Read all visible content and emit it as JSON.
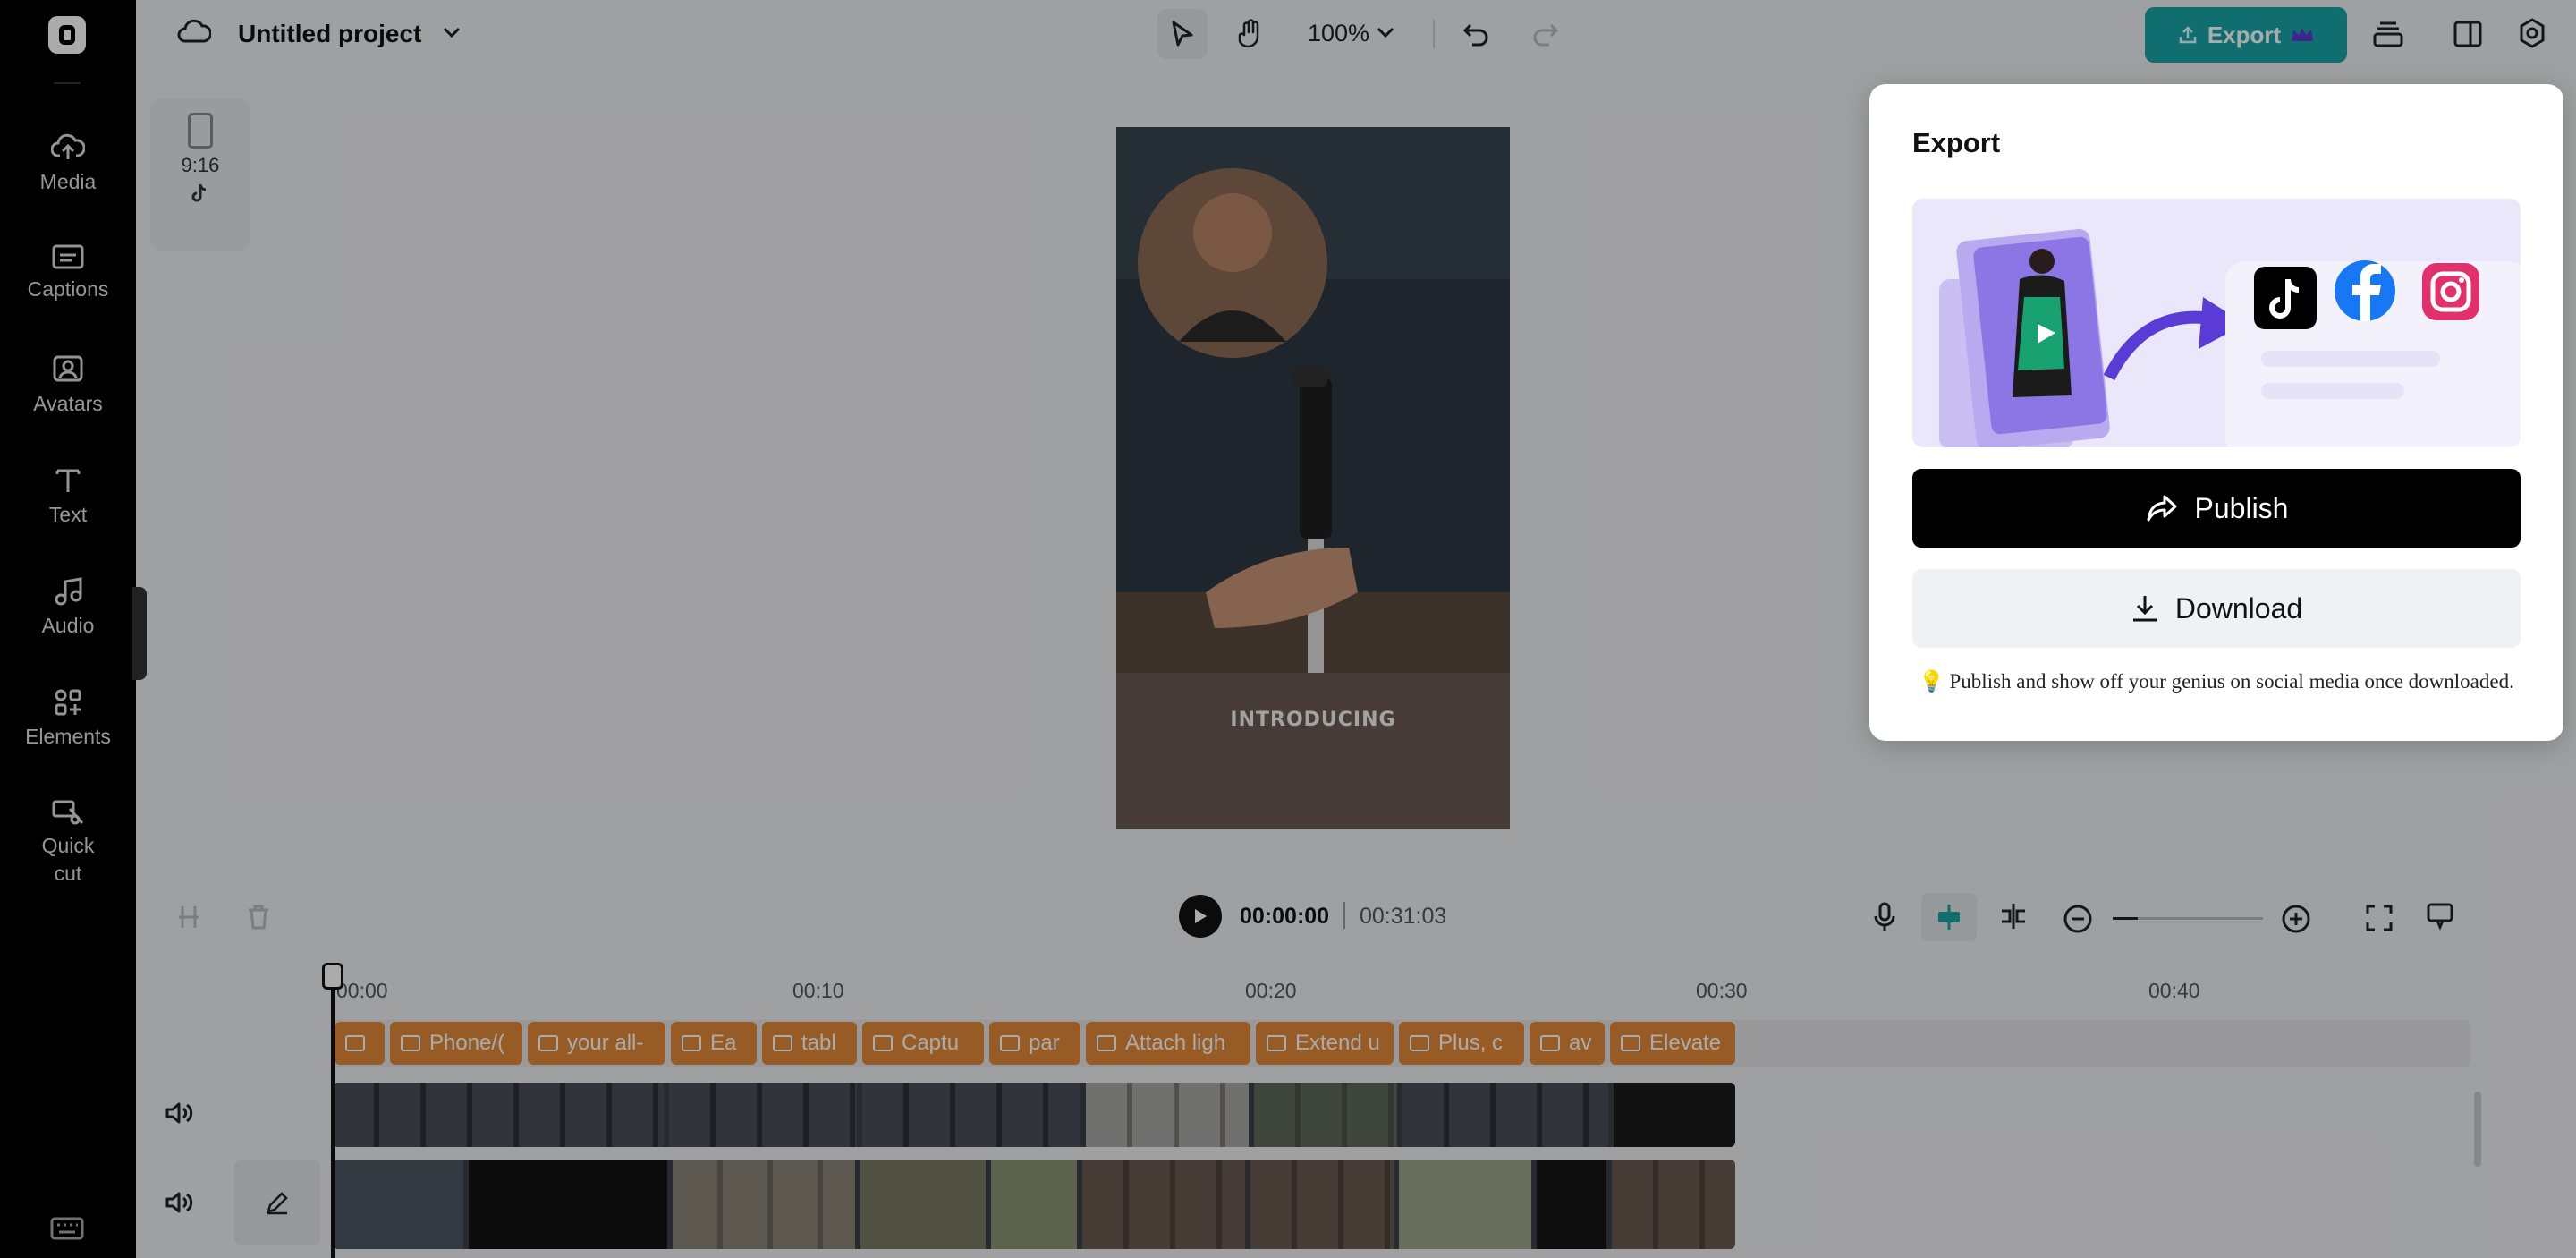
{
  "project": {
    "title": "Untitled project"
  },
  "toolbar": {
    "zoom": "100%",
    "export_label": "Export"
  },
  "sidebar": {
    "items": [
      {
        "label": "Media",
        "icon": "cloud-upload-icon"
      },
      {
        "label": "Captions",
        "icon": "captions-icon"
      },
      {
        "label": "Avatars",
        "icon": "avatar-icon"
      },
      {
        "label": "Text",
        "icon": "text-icon"
      },
      {
        "label": "Audio",
        "icon": "music-note-icon"
      },
      {
        "label": "Elements",
        "icon": "elements-icon"
      },
      {
        "label": "Quick\ncut",
        "icon": "scissors-icon"
      }
    ]
  },
  "canvas": {
    "ratio_label": "9:16",
    "caption_overlay": "INTRODUCING"
  },
  "export_popup": {
    "title": "Export",
    "publish_label": "Publish",
    "download_label": "Download",
    "tip": "Publish and show off your genius on social media once downloaded.",
    "social_icons": [
      "tiktok-icon",
      "facebook-icon",
      "instagram-icon"
    ]
  },
  "player": {
    "current_time": "00:00:00",
    "total_time": "00:31:03"
  },
  "timeline": {
    "ruler": [
      "00:00",
      "00:10",
      "00:20",
      "00:30",
      "00:40"
    ],
    "caption_clips": [
      "",
      "Phone/(",
      "your all-",
      "Ea",
      "tabl",
      "Captu",
      "par",
      "Attach ligh",
      "Extend u",
      "Plus, c",
      "av",
      "Elevate"
    ]
  },
  "colors": {
    "accent": "#1aa4a8",
    "caption_clip": "#e28a3a",
    "sidebar_bg": "#000000"
  }
}
